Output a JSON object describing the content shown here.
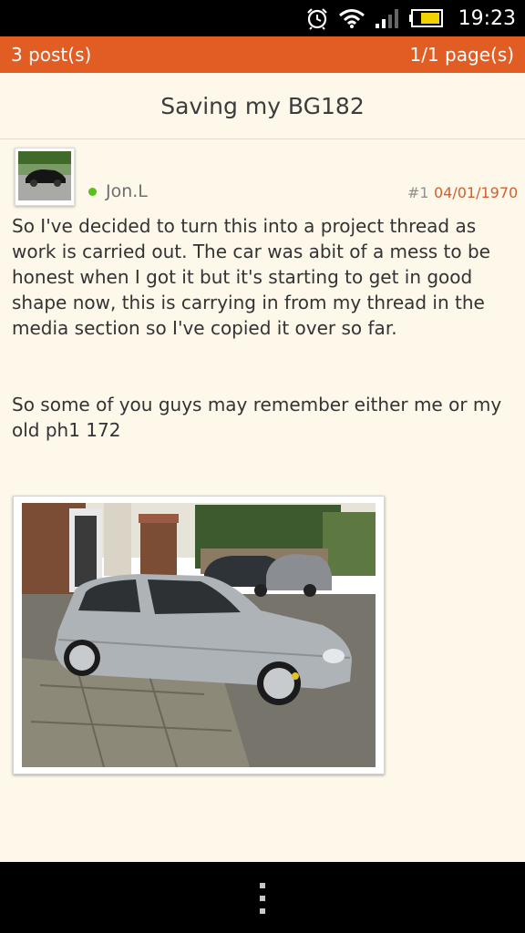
{
  "status_bar": {
    "time": "19:23",
    "icons": [
      "alarm-icon",
      "wifi-icon",
      "signal-icon",
      "battery-icon"
    ]
  },
  "toolbar": {
    "posts": "3 post(s)",
    "pages": "1/1 page(s)"
  },
  "thread": {
    "title": "Saving my BG182"
  },
  "post": {
    "author": "Jon.L",
    "number": "#1",
    "date": "04/01/1970",
    "paragraph1": "So I've decided to turn this into a project thread as work is carried out. The car was abit of a mess to be honest when I got it but it's starting to get in good shape now, this is carrying in from my thread in the media section so I've copied it over so far.",
    "paragraph2": "So some of you guys may remember either me or my old ph1 172"
  },
  "colors": {
    "accent": "#e25d24",
    "background": "#fdf8ea",
    "online": "#55c11a",
    "date": "#d2602e"
  },
  "nav_bar": {
    "icons": [
      "overflow-menu-icon"
    ]
  }
}
